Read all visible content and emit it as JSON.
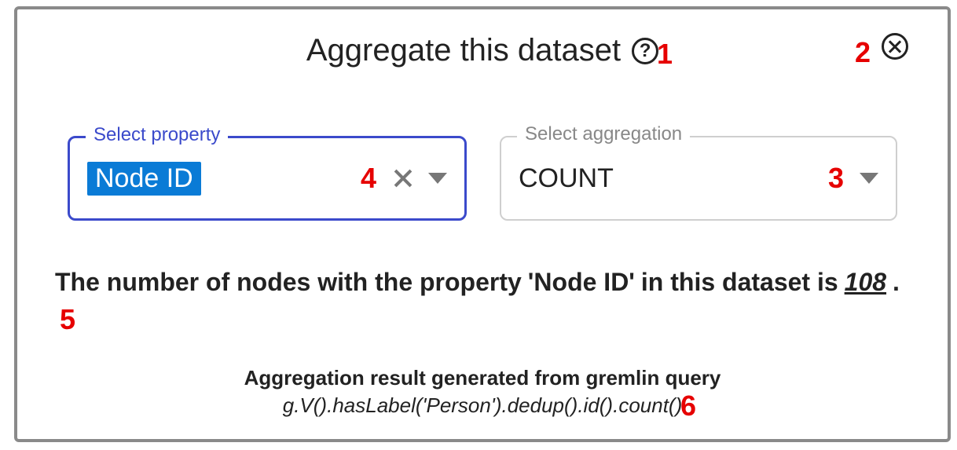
{
  "dialog": {
    "title": "Aggregate this dataset"
  },
  "annotations": {
    "a1": "1",
    "a2": "2",
    "a3": "3",
    "a4": "4",
    "a5": "5",
    "a6": "6"
  },
  "property": {
    "legend": "Select property",
    "value": "Node ID"
  },
  "aggregation": {
    "legend": "Select aggregation",
    "value": "COUNT"
  },
  "result": {
    "prefix": "The number of nodes with the property",
    "property_quoted": "'Node ID'",
    "mid": "in this dataset is",
    "value": "108",
    "suffix": "."
  },
  "query": {
    "caption": "Aggregation result generated from gremlin query",
    "text": "g.V().hasLabel('Person').dedup().id().count()"
  }
}
